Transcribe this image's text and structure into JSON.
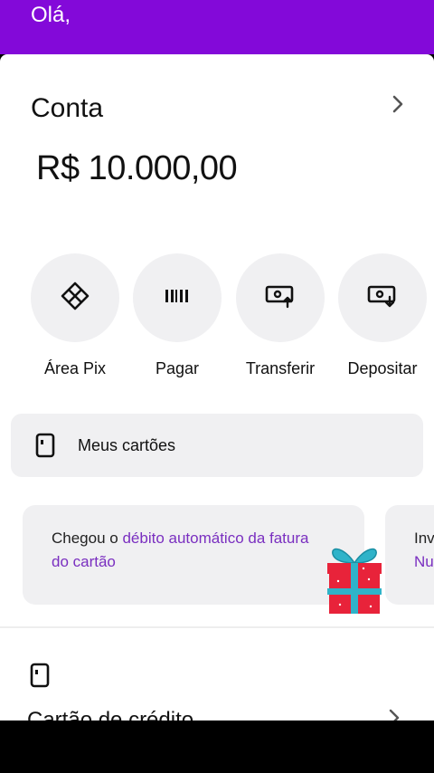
{
  "header": {
    "greeting": "Olá,"
  },
  "account": {
    "title": "Conta",
    "balance": "R$ 10.000,00"
  },
  "actions": [
    {
      "label": "Área Pix",
      "icon": "pix-icon"
    },
    {
      "label": "Pagar",
      "icon": "barcode-icon"
    },
    {
      "label": "Transferir",
      "icon": "transfer-icon"
    },
    {
      "label": "Depositar",
      "icon": "deposit-icon"
    }
  ],
  "cards_button": {
    "label": "Meus cartões",
    "icon": "card-icon"
  },
  "promo": {
    "text_plain": "Chegou o ",
    "text_highlight": "débito automático da fatura do cartão",
    "icon": "gift-icon"
  },
  "promo2": {
    "line1": "Inv",
    "line2": "Nu"
  },
  "credit": {
    "title": "Cartão de crédito",
    "icon": "card-icon"
  },
  "colors": {
    "brand": "#8309d9",
    "highlight": "#7a2fc0",
    "surface": "#f0f0f2"
  }
}
